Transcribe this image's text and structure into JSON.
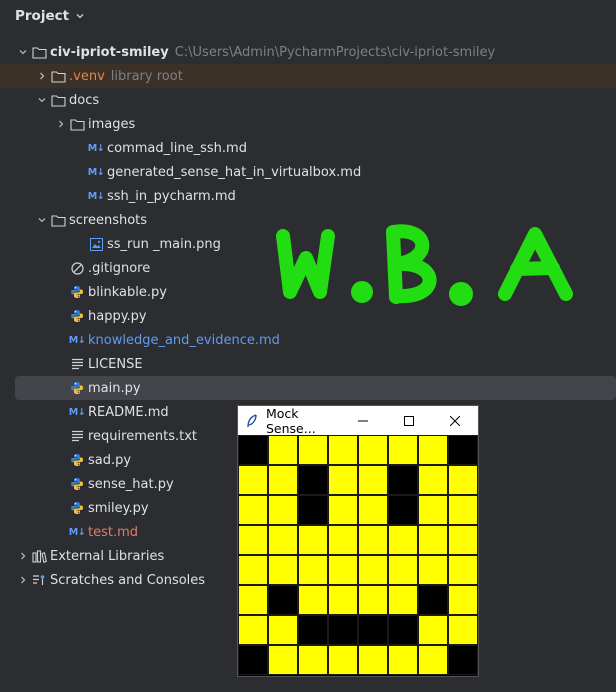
{
  "panel": {
    "title": "Project"
  },
  "tree": [
    {
      "id": "root",
      "depth": 0,
      "expand": "down",
      "icon": "folder",
      "name": "civ-ipriot-smiley",
      "style": "bold",
      "hint": "C:\\Users\\Admin\\PycharmProjects\\civ-ipriot-smiley"
    },
    {
      "id": "venv",
      "depth": 1,
      "expand": "right",
      "icon": "folder",
      "name": ".venv",
      "style": "orange",
      "hint": "library root"
    },
    {
      "id": "docs",
      "depth": 1,
      "expand": "down",
      "icon": "folder",
      "name": "docs",
      "style": ""
    },
    {
      "id": "images",
      "depth": 2,
      "expand": "right",
      "icon": "folder",
      "name": "images",
      "style": ""
    },
    {
      "id": "cmd",
      "depth": 3,
      "expand": "",
      "icon": "md",
      "name": "commad_line_ssh.md",
      "style": ""
    },
    {
      "id": "gen",
      "depth": 3,
      "expand": "",
      "icon": "md",
      "name": "generated_sense_hat_in_virtualbox.md",
      "style": ""
    },
    {
      "id": "ssh",
      "depth": 3,
      "expand": "",
      "icon": "md",
      "name": "ssh_in_pycharm.md",
      "style": ""
    },
    {
      "id": "screens",
      "depth": 1,
      "expand": "down",
      "icon": "folder",
      "name": "screenshots",
      "style": ""
    },
    {
      "id": "ssrun",
      "depth": 3,
      "expand": "",
      "icon": "image",
      "name": "ss_run _main.png",
      "style": ""
    },
    {
      "id": "gitignore",
      "depth": 2,
      "expand": "",
      "icon": "ignore",
      "name": ".gitignore",
      "style": ""
    },
    {
      "id": "blink",
      "depth": 2,
      "expand": "",
      "icon": "python",
      "name": "blinkable.py",
      "style": ""
    },
    {
      "id": "happy",
      "depth": 2,
      "expand": "",
      "icon": "python",
      "name": "happy.py",
      "style": ""
    },
    {
      "id": "know",
      "depth": 2,
      "expand": "",
      "icon": "md",
      "name": "knowledge_and_evidence.md",
      "style": "blue"
    },
    {
      "id": "lic",
      "depth": 2,
      "expand": "",
      "icon": "text",
      "name": "LICENSE",
      "style": ""
    },
    {
      "id": "main",
      "depth": 2,
      "expand": "",
      "icon": "python",
      "name": "main.py",
      "style": "",
      "selected": true
    },
    {
      "id": "readme",
      "depth": 2,
      "expand": "",
      "icon": "md",
      "name": "README.md",
      "style": ""
    },
    {
      "id": "req",
      "depth": 2,
      "expand": "",
      "icon": "text",
      "name": "requirements.txt",
      "style": ""
    },
    {
      "id": "sad",
      "depth": 2,
      "expand": "",
      "icon": "python",
      "name": "sad.py",
      "style": ""
    },
    {
      "id": "sense",
      "depth": 2,
      "expand": "",
      "icon": "python",
      "name": "sense_hat.py",
      "style": ""
    },
    {
      "id": "smiley",
      "depth": 2,
      "expand": "",
      "icon": "python",
      "name": "smiley.py",
      "style": ""
    },
    {
      "id": "test",
      "depth": 2,
      "expand": "",
      "icon": "md",
      "name": "test.md",
      "style": "red"
    },
    {
      "id": "ext",
      "depth": 0,
      "expand": "right",
      "icon": "library",
      "name": "External Libraries",
      "style": ""
    },
    {
      "id": "scratch",
      "depth": 0,
      "expand": "right",
      "icon": "scratch",
      "name": "Scratches and Consoles",
      "style": ""
    }
  ],
  "overlay_text": "W.B. A",
  "overlay_color": "#22dd11",
  "mock_window": {
    "title": "Mock Sense...",
    "grid": [
      "kyyyyyyk",
      "yykyykyy",
      "yykyykyy",
      "yyyyyyyy",
      "yyyyyyyy",
      "ykyyyyky",
      "yykkkkyy",
      "kyyyyyyk"
    ]
  }
}
